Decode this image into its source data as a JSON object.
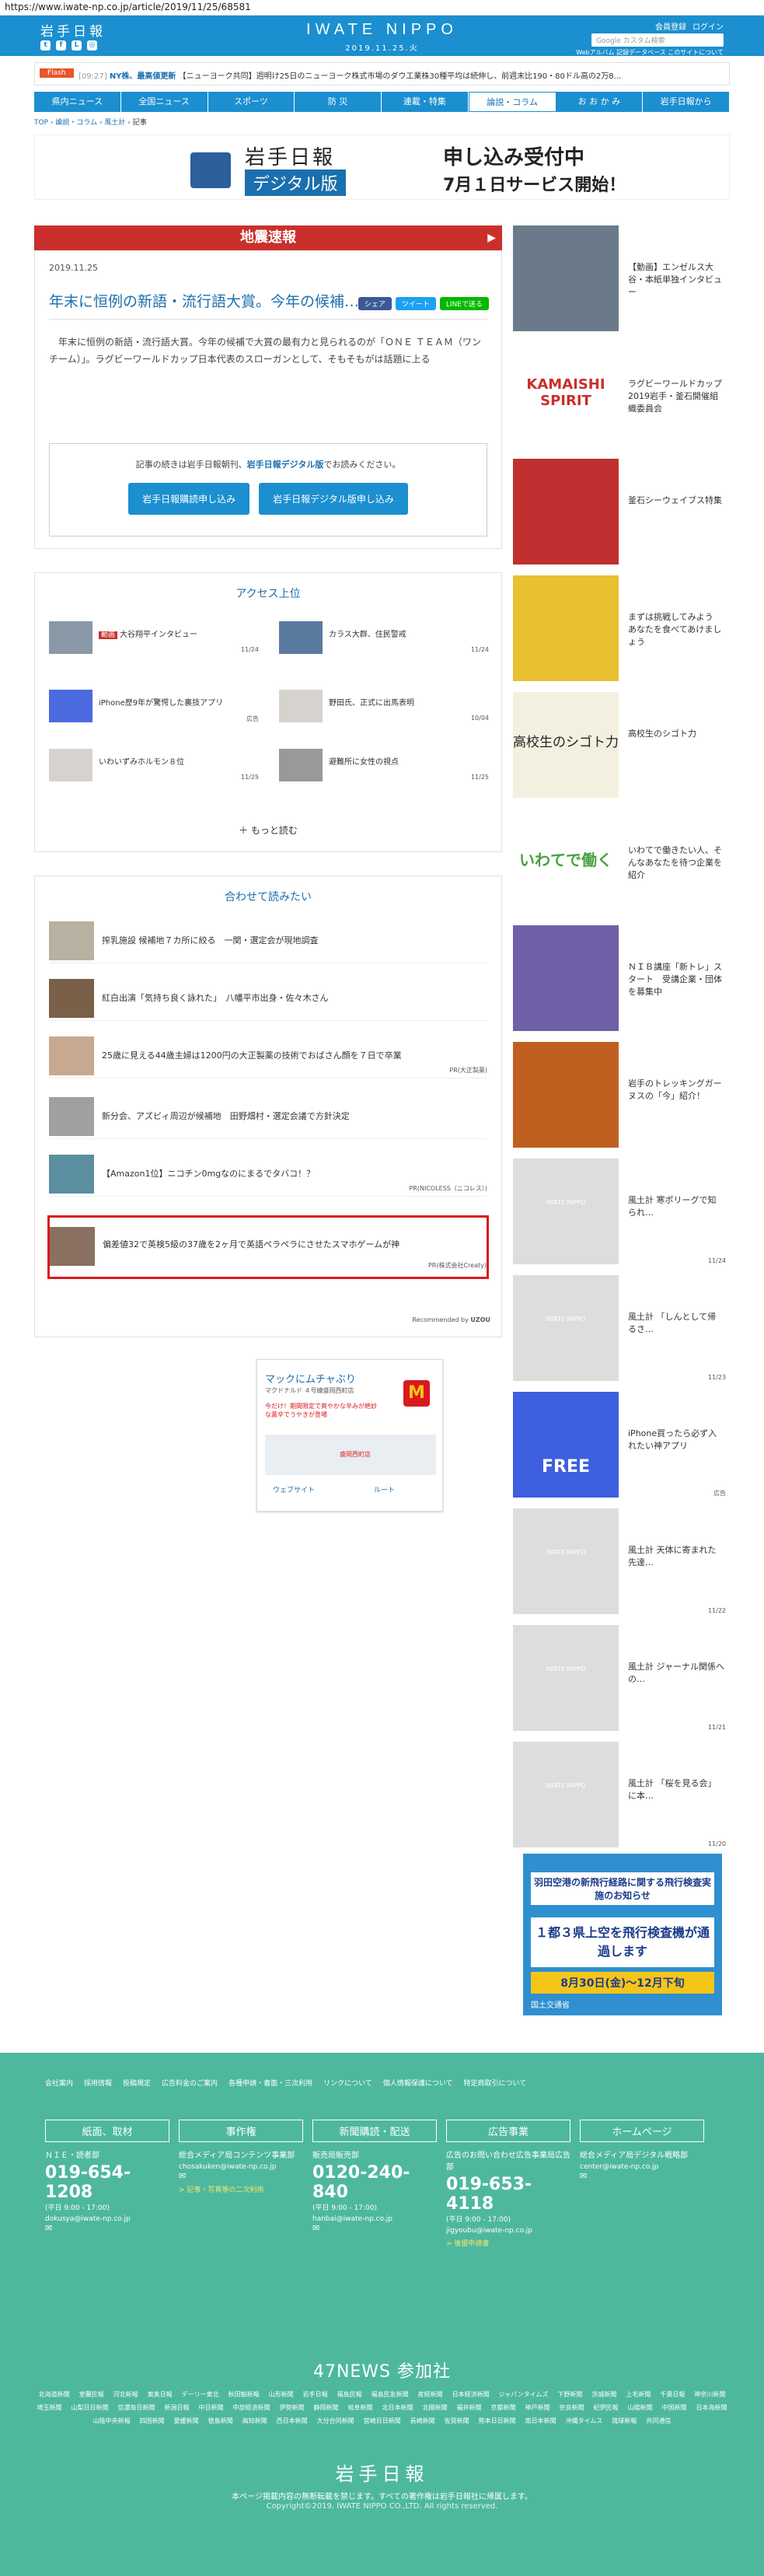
{
  "url": "https://www.iwate-np.co.jp/article/2019/11/25/68581",
  "header": {
    "logo_jp": "岩手日報",
    "logo_en": "IWATE NIPPO",
    "date": "2019.11.25.火",
    "links": [
      "会員登録",
      "ログイン"
    ],
    "search_placeholder": "Google カスタム検索",
    "sublinks": "Webアルバム  記録データベース  このサイトについて"
  },
  "flash": {
    "tag": "Flash",
    "time": "[09:27]",
    "title": "NY株、最高値更新",
    "text": "【ニューヨーク共同】週明け25日のニューヨーク株式市場のダウ工業株30種平均は続伸し、前週末比190・80ドル高の2万8...",
    "color": "#e8562a"
  },
  "nav": [
    "県内ニュース",
    "全国ニュース",
    "スポーツ",
    "防 災",
    "連載・特集",
    "論説・コラム",
    "お お か み",
    "岩手日報から"
  ],
  "breadcrumb": [
    "TOP",
    "論説・コラム",
    "風土計",
    "記事"
  ],
  "banner": {
    "l1": "岩手日報",
    "l2": "デジタル版",
    "r1": "申し込み受付中",
    "r2": "7月１日サービス開始！"
  },
  "alert": "地震速報",
  "article": {
    "date": "2019.11.25",
    "share": [
      "シェア",
      "ツイート",
      "LINEで送る"
    ],
    "headline": "年末に恒例の新語・流行語大賞。今年の候補…",
    "body": "　年末に恒例の新語・流行語大賞。今年の候補で大賞の最有力と見られるのが「ＯＮＥ ＴＥＡＭ（ワンチーム）」。ラグビーワールドカップ日本代表のスローガンとして、そもそもがは話題に上る",
    "notice_pre": "記事の続きは岩手日報朝刊、",
    "notice_link": "岩手日報デジタル版",
    "notice_post": "でお読みください。",
    "btn1": "岩手日報購読申し込み",
    "btn2": "岩手日報デジタル版申し込み"
  },
  "ranking": {
    "title": "アクセス上位",
    "items": [
      {
        "badge": "動画",
        "title": "大谷翔平インタビュー",
        "date": "11/24"
      },
      {
        "badge": "",
        "title": "カラス大群、住民警戒",
        "date": "11/24"
      },
      {
        "badge": "",
        "title": "iPhone歴9年が驚愕した裏技アプリ",
        "date": "広告"
      },
      {
        "badge": "",
        "title": "野田氏、正式に出馬表明",
        "date": "10/04"
      },
      {
        "badge": "",
        "title": "いわいずみホルモン８位",
        "date": "11/25"
      },
      {
        "badge": "",
        "title": "避難所に女性の視点",
        "date": "11/25"
      }
    ],
    "more": "もっと読む"
  },
  "related": {
    "title": "合わせて読みたい",
    "items": [
      {
        "title": "搾乳施設 候補地７カ所に絞る　一関・選定会が現地調査",
        "pr": ""
      },
      {
        "title": "紅白出演「気持ち良く詠れた」　八幡平市出身・佐々木さん",
        "pr": ""
      },
      {
        "title": "25歳に見える44歳主婦は1200円の大正製薬の技術でおばさん顔を７日で卒業",
        "pr": "PR(大正製薬)"
      },
      {
        "title": "新分会、アズビィ周辺が候補地　田野畑村・選定会議で方針決定",
        "pr": ""
      },
      {
        "title": "【Amazon1位】ニコチン0mgなのにまるでタバコ！？",
        "pr": "PR(NICOLESS（ニコレス）)"
      },
      {
        "title": "偏差値32で英検5級の37歳を2ヶ月で英語ペラペラにさせたスマホゲームが神",
        "pr": "PR(株式会社Creaty)"
      }
    ],
    "recommended": "Recommended by",
    "recommended_brand": "UZOU"
  },
  "map_ad": {
    "name": "マックにムチャぶり",
    "sub": "マクドナルド ４号線盛岡西町店",
    "desc": "今だけ！期間限定で爽やかな辛みが絶妙な薫辛でうやきが登場",
    "place": "盛岡西町店",
    "b1": "ウェブサイト",
    "b2": "ルート"
  },
  "sidebar": [
    {
      "title": "【動画】エンゼルス大谷・本紙単独インタビュー",
      "date": "",
      "img": "person"
    },
    {
      "title": "ラグビーワールドカップ2019岩手・釜石開催組織委員会",
      "date": "",
      "img": "KAMAISHI SPIRIT"
    },
    {
      "title": "釜石シーウェイブス特集",
      "date": "",
      "img": "team"
    },
    {
      "title": "まずは挑戦してみよう　あなたを食べてあけましょう",
      "date": "",
      "img": "cat"
    },
    {
      "title": "高校生のシゴト力",
      "date": "",
      "img": "高校生のシゴト力"
    },
    {
      "title": "いわてで働きたい人、そんなあなたを待つ企業を紹介",
      "date": "",
      "img": "いわてで働く"
    },
    {
      "title": "ＮＩＢ講座「新トレ」スタート　受講企業・団体を募集中",
      "date": "",
      "img": "poster"
    },
    {
      "title": "岩手のトレッキングガーヌスの「今」紹介！",
      "date": "",
      "img": "autumn"
    },
    {
      "title": "風土計 寒ポリーグで知られ…",
      "date": "11/24",
      "img": "ph"
    },
    {
      "title": "風土計 「しんとして帰るさ…",
      "date": "11/23",
      "img": "ph"
    },
    {
      "title": "iPhone買ったら必ず入れたい神アプリ",
      "date": "広告",
      "img": "wifi"
    },
    {
      "title": "風土計 天体に寄まれた先達…",
      "date": "11/22",
      "img": "ph"
    },
    {
      "title": "風土計 ジャーナル関係への…",
      "date": "11/21",
      "img": "ph"
    },
    {
      "title": "風土計 「桜を見る会」に本…",
      "date": "11/20",
      "img": "ph"
    }
  ],
  "side_ad": {
    "l1": "羽田空港の新飛行経路に関する飛行検査実施のお知らせ",
    "l2": "１都３県上空を飛行検査機が通過します",
    "l3": "8月30日(金)〜12月下旬",
    "l4": "国土交通省"
  },
  "footer": {
    "links": [
      "会社案内",
      "採用情報",
      "投稿規定",
      "広告料金のご案内",
      "各種申請・書面・三次利用",
      "リンクについて",
      "個人情報保護について",
      "特定商取引について"
    ],
    "cols": [
      {
        "h": "紙面、取材",
        "s": "ＮＩＥ・読者部",
        "ph": "019-654-1208",
        "t": "(平日 9:00 - 17:00)",
        "e": "dokusya@iwate-np.co.jp",
        "a": ""
      },
      {
        "h": "事作権",
        "s": "総合メディア局コンテンツ事業部",
        "ph": "",
        "t": "",
        "e": "chosakuken@iwate-np.co.jp",
        "a": "> 記事・写真等の二次利用"
      },
      {
        "h": "新聞購読・配送",
        "s": "販売局販売部",
        "ph": "0120-240-840",
        "t": "(平日 9:00 - 17:00)",
        "e": "hanbai@iwate-np.co.jp",
        "a": ""
      },
      {
        "h": "広告事業",
        "s": "広告のお問い合わせ広告事業局広告部",
        "ph": "019-653-4118",
        "t": "(平日 9:00 - 17:00)",
        "e": "jigyoubu@iwate-np.co.jp",
        "a": "> 後援申請書"
      },
      {
        "h": "ホームページ",
        "s": "総合メディア局デジタル戦略部",
        "ph": "",
        "t": "",
        "e": "center@iwate-np.co.jp",
        "a": ""
      }
    ],
    "n47": "47NEWS 参加社",
    "papers": [
      "北海道新聞",
      "室蘭民報",
      "河北新報",
      "東奥日報",
      "デーリー東北",
      "秋田魁新報",
      "山形新聞",
      "岩手日報",
      "福島民報",
      "福島民友新聞",
      "産経新聞",
      "日本経済新聞",
      "ジャパンタイムズ",
      "下野新聞",
      "茨城新聞",
      "上毛新聞",
      "千葉日報",
      "神奈川新聞",
      "埼玉新聞",
      "山梨日日新聞",
      "信濃毎日新聞",
      "新潟日報",
      "中日新聞",
      "中部経済新聞",
      "伊勢新聞",
      "静岡新聞",
      "岐阜新聞",
      "北日本新聞",
      "北國新聞",
      "福井新聞",
      "京都新聞",
      "神戸新聞",
      "奈良新聞",
      "紀伊民報",
      "山陽新聞",
      "中国新聞",
      "日本海新聞",
      "山陰中央新報",
      "四国新聞",
      "愛媛新聞",
      "徳島新聞",
      "高知新聞",
      "西日本新聞",
      "大分合同新聞",
      "宮崎日日新聞",
      "長崎新聞",
      "佐賀新聞",
      "熊本日日新聞",
      "南日本新聞",
      "沖縄タイムス",
      "琉球新報",
      "共同通信"
    ],
    "logo": "岩手日報",
    "copy1": "本ページ掲載内容の無断転載を禁じます。すべての著作権は岩手日報社に帰属します。",
    "copy2": "Copyright©2019, IWATE NIPPO CO.,LTD. All rights reserved."
  },
  "colors": {
    "brand": "#1b8fcf",
    "alert": "#c9302c",
    "footer": "#4eb89f",
    "highlight": "#d9191f"
  }
}
